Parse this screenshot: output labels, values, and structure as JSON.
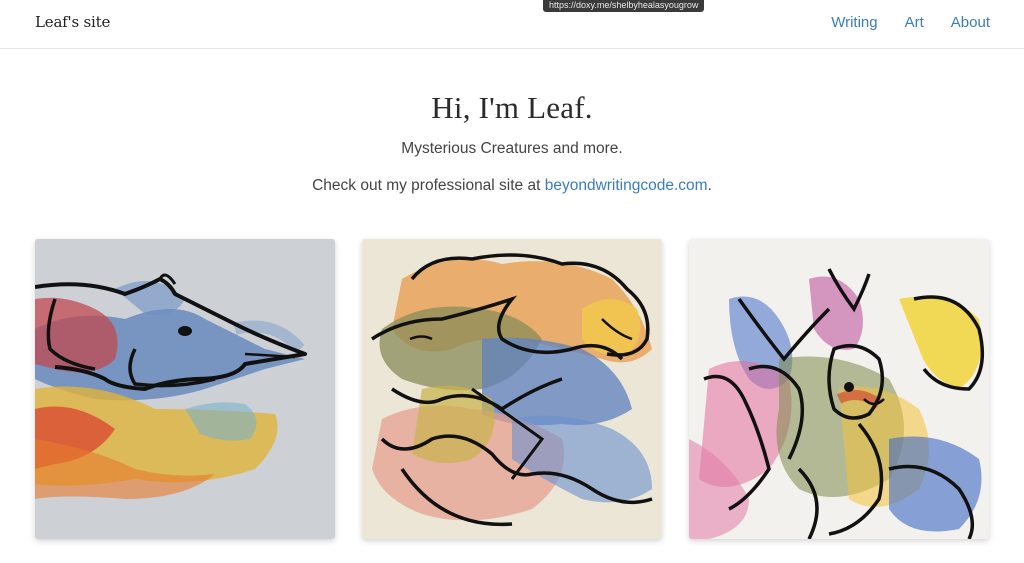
{
  "browser": {
    "status_url": "https://doxy.me/shelbyhealasyougrow"
  },
  "navbar": {
    "brand": "Leaf's site",
    "links": [
      {
        "label": "Writing"
      },
      {
        "label": "Art"
      },
      {
        "label": "About"
      }
    ]
  },
  "hero": {
    "title": "Hi, I'm Leaf.",
    "tagline": "Mysterious Creatures and more.",
    "professional_prefix": "Check out my professional site at ",
    "professional_link": "beyondwritingcode.com",
    "professional_suffix": "."
  },
  "gallery": {
    "items": [
      {
        "icon": "watercolor-fish-creature"
      },
      {
        "icon": "watercolor-bird-creature"
      },
      {
        "icon": "watercolor-cat-creature"
      }
    ]
  },
  "colors": {
    "link": "#3b7bbf",
    "text": "#444444",
    "title": "#2b2b2b"
  }
}
